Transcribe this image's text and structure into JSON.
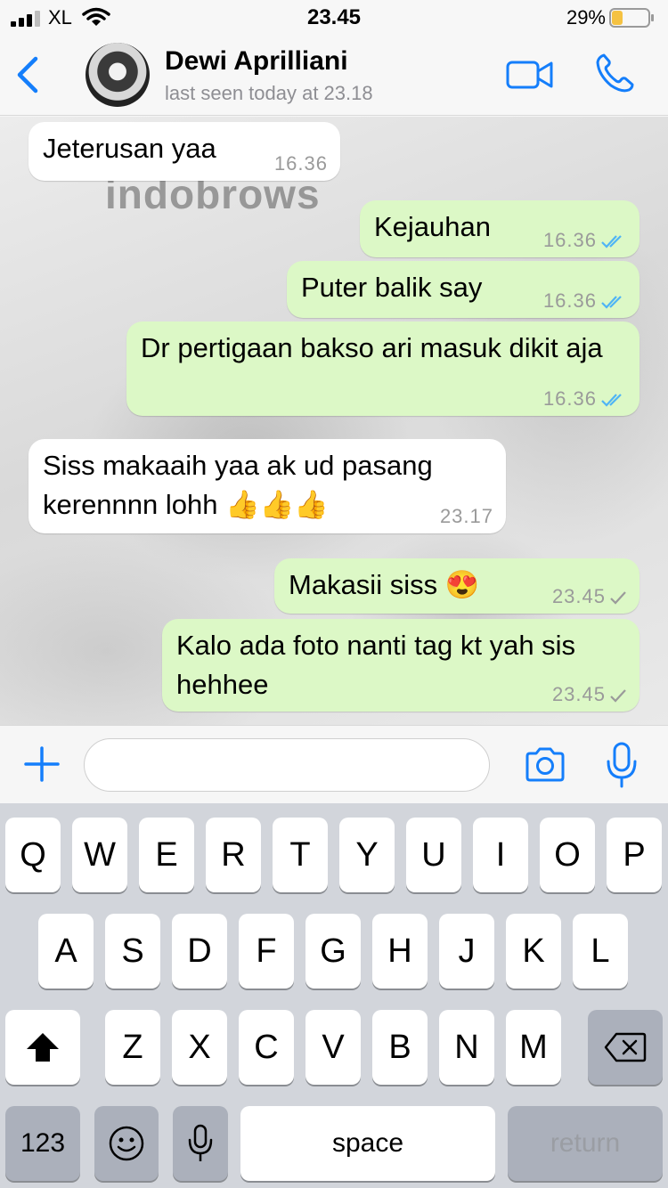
{
  "status_bar": {
    "carrier": "XL",
    "time": "23.45",
    "battery_percent": "29%",
    "battery_level": 0.29,
    "battery_color": "#f5c242"
  },
  "header": {
    "contact_name": "Dewi Aprilliani",
    "last_seen": "last seen today at 23.18",
    "accent": "#147efb"
  },
  "watermark": "indobrows",
  "messages": [
    {
      "direction": "incoming",
      "text": "Jeterusan yaa",
      "time": "16.36"
    },
    {
      "direction": "outgoing",
      "text": "Kejauhan",
      "time": "16.36",
      "status": "read"
    },
    {
      "direction": "outgoing",
      "text": "Puter balik say",
      "time": "16.36",
      "status": "read"
    },
    {
      "direction": "outgoing",
      "text": "Dr pertigaan bakso ari masuk dikit aja",
      "time": "16.36",
      "status": "read"
    },
    {
      "direction": "incoming",
      "text": "Siss makaaih yaa ak ud pasang kerennnn lohh 👍👍👍",
      "time": "23.17"
    },
    {
      "direction": "outgoing",
      "text": "Makasii siss 😍",
      "time": "23.45",
      "status": "sent"
    },
    {
      "direction": "outgoing",
      "text": "Kalo ada foto nanti tag kt yah sis hehhee",
      "time": "23.45",
      "status": "sent"
    }
  ],
  "input": {
    "placeholder": ""
  },
  "keyboard": {
    "row1": [
      "Q",
      "W",
      "E",
      "R",
      "T",
      "Y",
      "U",
      "I",
      "O",
      "P"
    ],
    "row2": [
      "A",
      "S",
      "D",
      "F",
      "G",
      "H",
      "J",
      "K",
      "L"
    ],
    "row3": [
      "Z",
      "X",
      "C",
      "V",
      "B",
      "N",
      "M"
    ],
    "numbers_label": "123",
    "space_label": "space",
    "return_label": "return"
  },
  "icons": [
    "signal-icon",
    "wifi-icon",
    "battery-icon",
    "back-icon",
    "video-call-icon",
    "phone-icon",
    "plus-icon",
    "camera-icon",
    "mic-icon",
    "shift-icon",
    "backspace-icon",
    "emoji-icon",
    "dictation-icon"
  ]
}
